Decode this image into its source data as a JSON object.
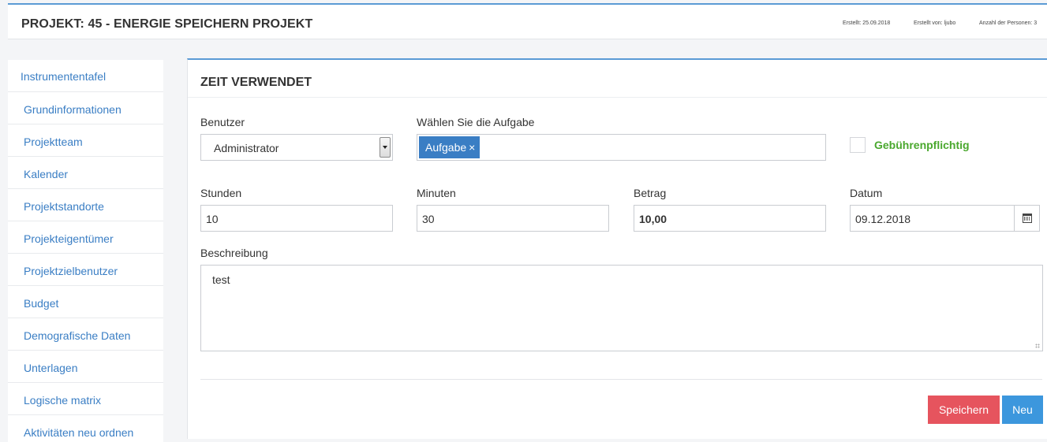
{
  "header": {
    "title": "PROJEKT: 45 - ENERGIE SPEICHERN PROJEKT",
    "created": "Erstellt: 25.09.2018",
    "created_by": "Erstellt von: ljubo",
    "persons": "Anzahl der Personen: 3"
  },
  "sidebar": {
    "items": [
      {
        "label": "Instrumententafel"
      },
      {
        "label": "Grundinformationen"
      },
      {
        "label": "Projektteam"
      },
      {
        "label": "Kalender"
      },
      {
        "label": "Projektstandorte"
      },
      {
        "label": "Projekteigentümer"
      },
      {
        "label": "Projektzielbenutzer"
      },
      {
        "label": "Budget"
      },
      {
        "label": "Demografische Daten"
      },
      {
        "label": "Unterlagen"
      },
      {
        "label": "Logische matrix"
      },
      {
        "label": "Aktivitäten neu ordnen"
      }
    ]
  },
  "form": {
    "title": "ZEIT VERWENDET",
    "user": {
      "label": "Benutzer",
      "value": "Administrator"
    },
    "task": {
      "label": "Wählen Sie die Aufgabe",
      "tag": "Aufgabe",
      "remove": "×"
    },
    "billable": {
      "label": "Gebührenpflichtig",
      "checked": false
    },
    "hours": {
      "label": "Stunden",
      "value": "10"
    },
    "minutes": {
      "label": "Minuten",
      "value": "30"
    },
    "amount": {
      "label": "Betrag",
      "value": "10,00"
    },
    "date": {
      "label": "Datum",
      "value": "09.12.2018"
    },
    "description": {
      "label": "Beschreibung",
      "value": "test"
    },
    "save_label": "Speichern",
    "new_label": "Neu"
  },
  "colors": {
    "accent": "#3a7ec4",
    "save": "#e6545e",
    "new": "#3c97dd",
    "billable": "#4aa82e"
  },
  "icons": {
    "select": "chevron-down-icon",
    "calendar": "calendar-icon",
    "remove": "close-icon"
  }
}
